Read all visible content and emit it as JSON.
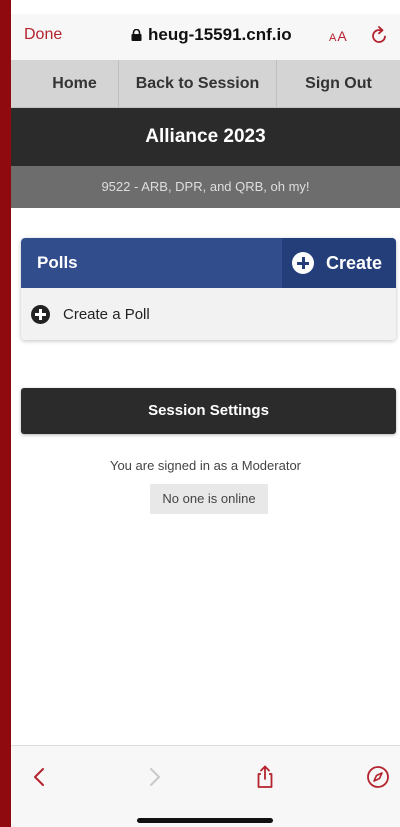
{
  "browser": {
    "done_label": "Done",
    "url": "heug-15591.cnf.io",
    "text_size_small": "A",
    "text_size_large": "A"
  },
  "nav": {
    "items": [
      {
        "label": "Home"
      },
      {
        "label": "Back to Session"
      },
      {
        "label": "Sign Out"
      }
    ]
  },
  "header": {
    "title": "Alliance 2023",
    "session": "9522 - ARB, DPR, and QRB, oh my!"
  },
  "polls": {
    "title": "Polls",
    "create_label": "Create",
    "create_poll_label": "Create a Poll"
  },
  "settings": {
    "button_label": "Session Settings",
    "signed_in_text": "You are signed in as a Moderator",
    "online_status": "No one is online"
  },
  "colors": {
    "accent": "#b4232e",
    "polls_header": "#324d8c",
    "dark_bar": "#2b2b2b",
    "outer_border": "#8e0a0f"
  },
  "icons": [
    "lock-icon",
    "reload-icon",
    "plus-circle-icon",
    "back-icon",
    "forward-icon",
    "share-icon",
    "compass-icon"
  ]
}
